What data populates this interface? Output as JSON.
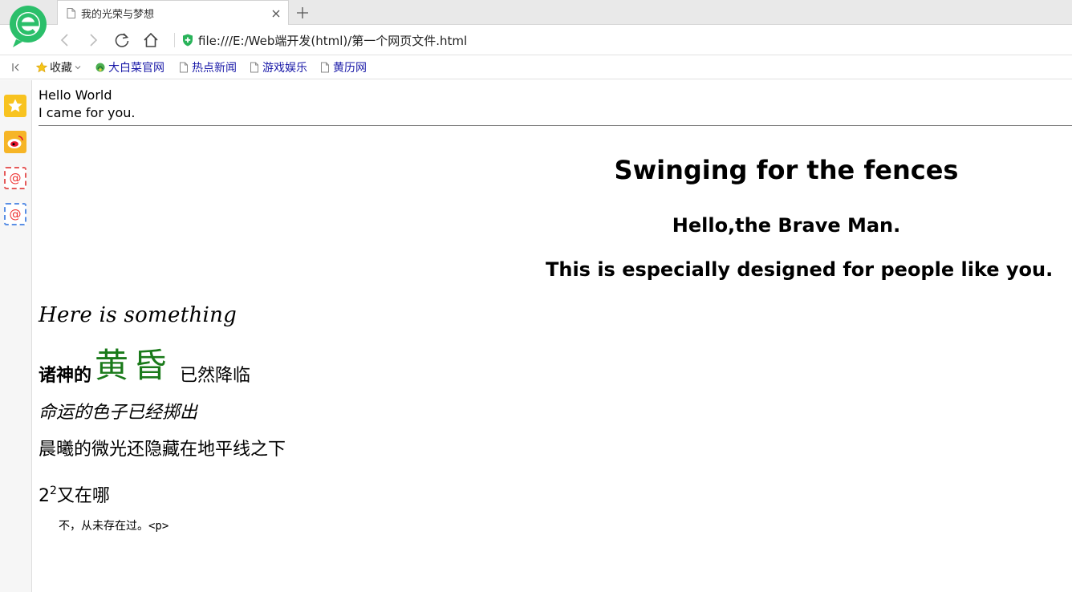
{
  "browser": {
    "tab_title": "我的光荣与梦想",
    "address": "file:///E:/Web端开发(html)/第一个网页文件.html"
  },
  "bookmarks": {
    "favorites_label": "收藏",
    "items": [
      {
        "label": "大白菜官网",
        "icon": "cabbage-icon"
      },
      {
        "label": "热点新闻",
        "icon": "page-icon"
      },
      {
        "label": "游戏娱乐",
        "icon": "page-icon"
      },
      {
        "label": "黄历网",
        "icon": "page-icon"
      }
    ]
  },
  "sidebar": {
    "items": [
      "star-icon",
      "weibo-icon",
      "mail-icon",
      "mail-icon"
    ]
  },
  "page": {
    "hello": "Hello World",
    "came": "I came for you.",
    "h1": "Swinging for the fences",
    "h2": "Hello,the Brave Man.",
    "h3": "This is especially designed for people like you.",
    "cursive": "Here is something",
    "gods_bold": "诸神的",
    "gods_green": "黄昏",
    "gods_rest": "已然降临",
    "fate": "命运的色子已经掷出",
    "dawn": "晨曦的微光还隐藏在地平线之下",
    "square_base": "2",
    "square_exp": "2",
    "square_rest": "又在哪",
    "pre_text": "不，从未存在过。<p>"
  },
  "colors": {
    "accent_green": "#1a7a1a",
    "link_blue": "#1a1aa8",
    "logo_green": "#2bbf6a"
  }
}
